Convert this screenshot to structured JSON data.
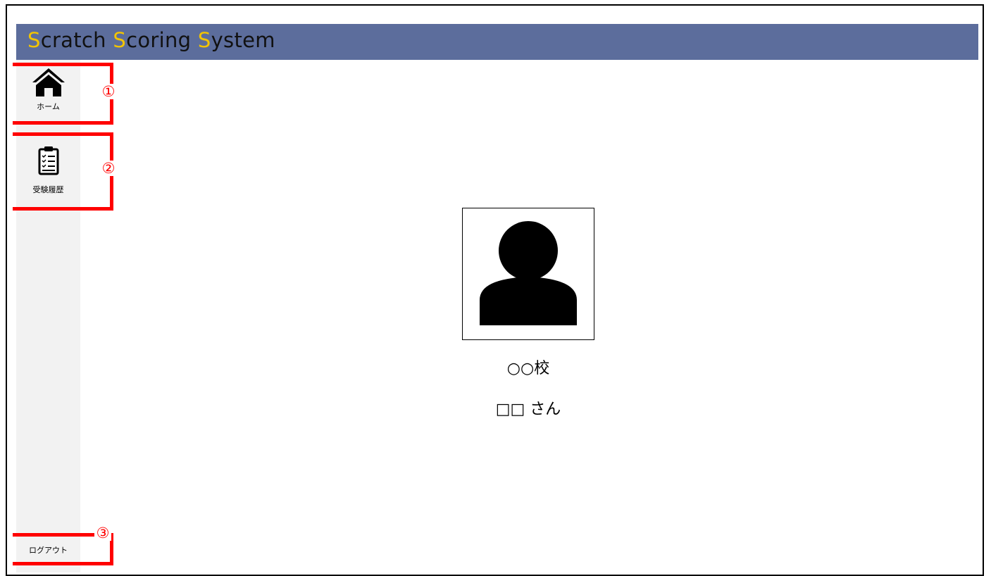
{
  "app": {
    "title_parts": [
      {
        "cap": "S",
        "rest": "cratch "
      },
      {
        "cap": "S",
        "rest": "coring "
      },
      {
        "cap": "S",
        "rest": "ystem"
      }
    ],
    "brand_color": "#5c6d9c",
    "accent_color": "#f2c400"
  },
  "sidebar": {
    "items": [
      {
        "label": "ホーム",
        "icon": "home-icon"
      },
      {
        "label": "受験履歴",
        "icon": "clipboard-checklist-icon"
      }
    ],
    "logout_label": "ログアウト"
  },
  "profile": {
    "icon": "user-avatar-icon",
    "school": "○○校",
    "student": "□□ さん"
  },
  "annotations": {
    "markers": [
      "①",
      "②",
      "③"
    ],
    "color": "#ff0000"
  }
}
